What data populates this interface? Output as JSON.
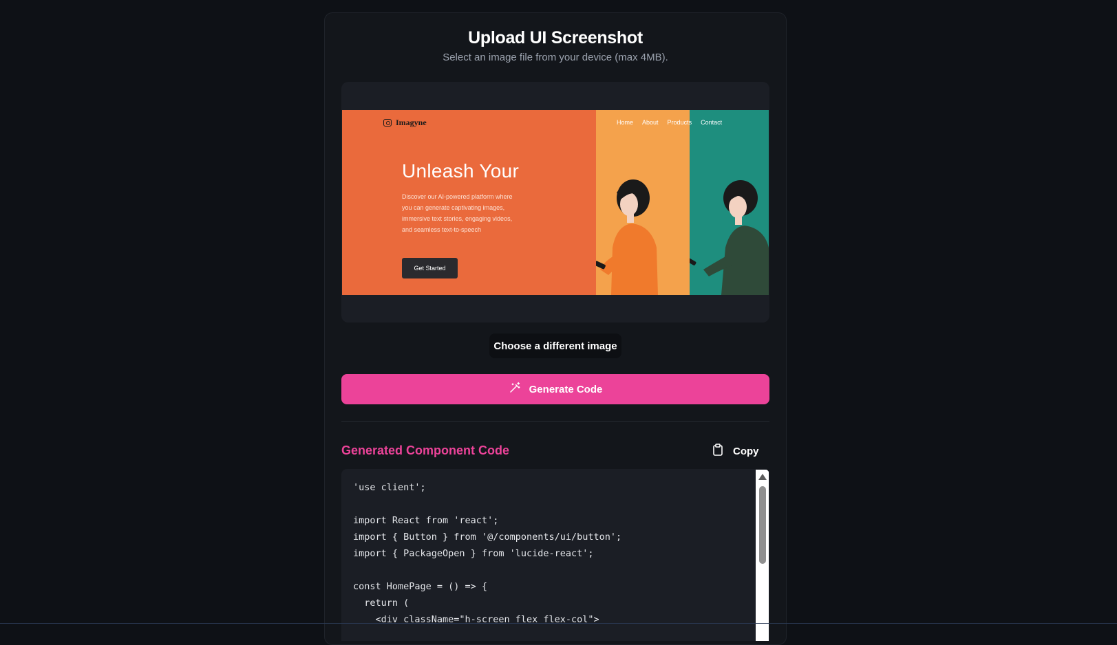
{
  "header": {
    "title": "Upload UI Screenshot",
    "subtitle": "Select an image file from your device (max 4MB)."
  },
  "preview": {
    "brand": "Imagyne",
    "nav": [
      "Home",
      "About",
      "Products",
      "Contact"
    ],
    "hero_heading": "Unleash Your",
    "description": "Discover our AI-powered platform where you can generate captivating images, immersive text stories, engaging videos, and seamless text-to-speech",
    "cta_label": "Get Started",
    "colors": {
      "left": "#ea6a3c",
      "middle": "#f4a24c",
      "right": "#1e8e7e"
    }
  },
  "actions": {
    "choose_label": "Choose a different image",
    "generate_label": "Generate Code",
    "generate_icon": "magic-wand-icon"
  },
  "result": {
    "title": "Generated Component Code",
    "copy_label": "Copy",
    "copy_icon": "clipboard-icon",
    "code_lines": [
      "'use client';",
      "",
      "import React from 'react';",
      "import { Button } from '@/components/ui/button';",
      "import { PackageOpen } from 'lucide-react';",
      "",
      "const HomePage = () => {",
      "  return (",
      "    <div className=\"h-screen flex flex-col\">"
    ]
  },
  "colors": {
    "accent": "#ec4399",
    "background": "#0e1116",
    "card": "#13161b"
  }
}
